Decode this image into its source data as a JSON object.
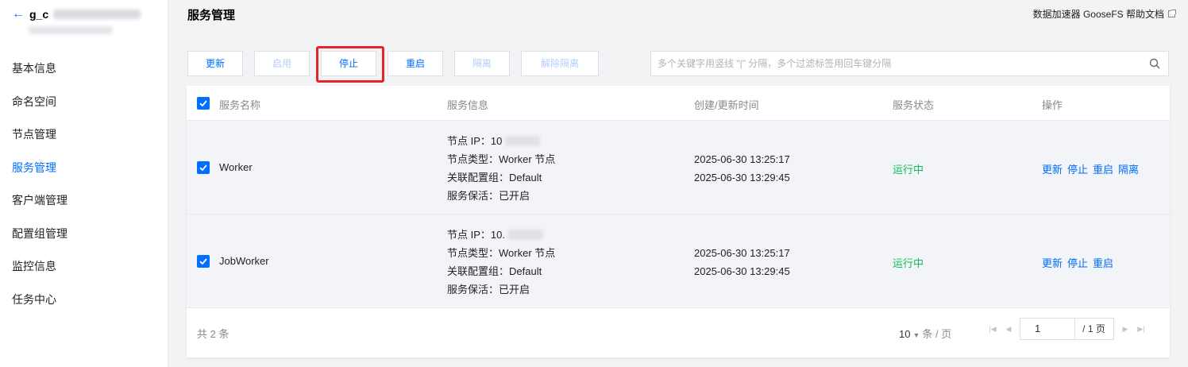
{
  "sidebar": {
    "back_title": "g_c",
    "items": [
      {
        "label": "基本信息"
      },
      {
        "label": "命名空间"
      },
      {
        "label": "节点管理"
      },
      {
        "label": "服务管理"
      },
      {
        "label": "客户端管理"
      },
      {
        "label": "配置组管理"
      },
      {
        "label": "监控信息"
      },
      {
        "label": "任务中心"
      }
    ],
    "active_item": "服务管理"
  },
  "header": {
    "title": "服务管理",
    "help_link": "数据加速器 GooseFS 帮助文档"
  },
  "toolbar": {
    "update": "更新",
    "enable": "启用",
    "stop": "停止",
    "restart": "重启",
    "isolate": "隔离",
    "unisolate": "解除隔离"
  },
  "search": {
    "placeholder": "多个关键字用竖线 \"|\" 分隔，多个过滤标签用回车键分隔",
    "value": ""
  },
  "table": {
    "columns": {
      "name": "服务名称",
      "info": "服务信息",
      "time": "创建/更新时间",
      "status": "服务状态",
      "ops": "操作"
    },
    "rows": [
      {
        "name": "Worker",
        "checked": true,
        "ip": "节点 IP：10",
        "node_type": "节点类型：Worker 节点",
        "config_group": "关联配置组：Default",
        "keepalive": "服务保活：已开启",
        "created": "2025-06-30 13:25:17",
        "updated": "2025-06-30 13:29:45",
        "status": "运行中",
        "actions": [
          "更新",
          "停止",
          "重启",
          "隔离"
        ]
      },
      {
        "name": "JobWorker",
        "checked": true,
        "ip": "节点 IP：10.",
        "node_type": "节点类型：Worker 节点",
        "config_group": "关联配置组：Default",
        "keepalive": "服务保活：已开启",
        "created": "2025-06-30 13:25:17",
        "updated": "2025-06-30 13:29:45",
        "status": "运行中",
        "actions": [
          "更新",
          "停止",
          "重启"
        ]
      }
    ]
  },
  "pagination": {
    "total": "共 2 条",
    "page_size": "10",
    "per_page_label": "条 / 页",
    "current_page": "1",
    "total_pages": "/ 1 页"
  },
  "colors": {
    "accent": "#006eff",
    "running": "#0abf5b",
    "highlight": "#e5242b"
  }
}
